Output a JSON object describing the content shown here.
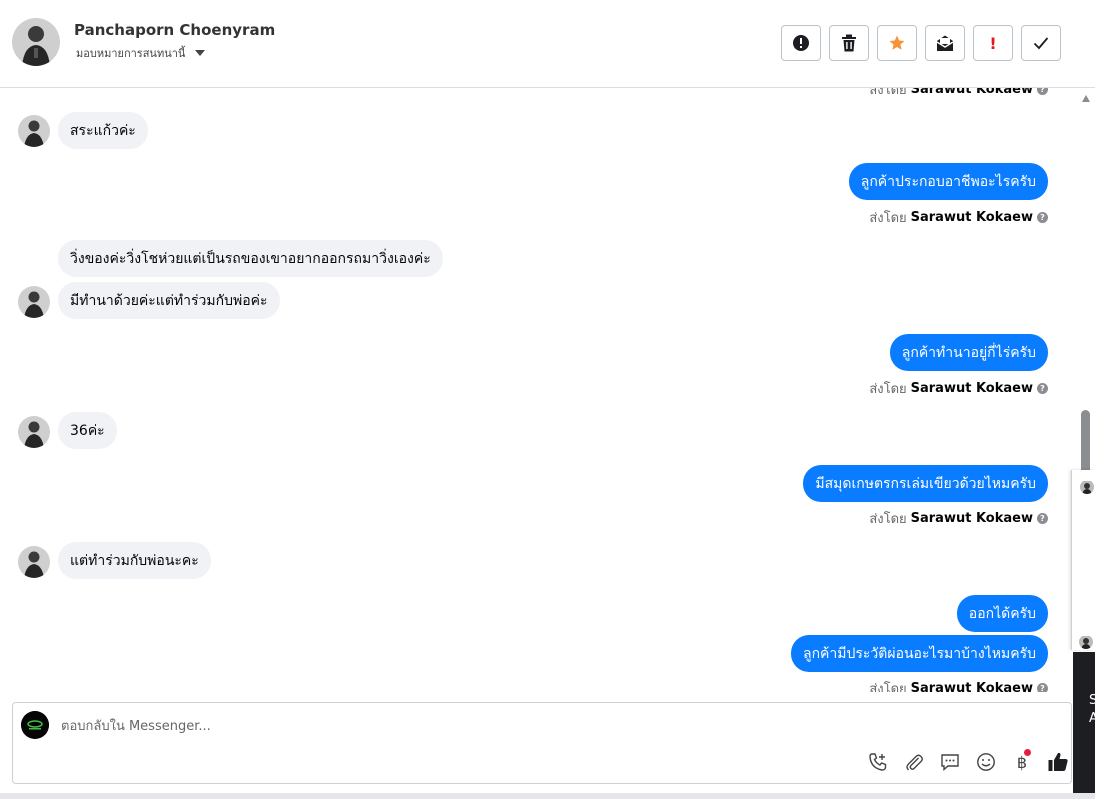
{
  "header": {
    "name": "Panchaporn Choenyram",
    "assign_label": "มอบหมายการสนทนานี้"
  },
  "actions": [
    {
      "name": "spam-alert-button",
      "icon": "alert-circle-icon"
    },
    {
      "name": "delete-button",
      "icon": "trash-icon"
    },
    {
      "name": "star-button",
      "icon": "star-icon"
    },
    {
      "name": "mark-unread-button",
      "icon": "envelope-icon"
    },
    {
      "name": "follow-up-button",
      "icon": "exclamation-icon",
      "label": "!"
    },
    {
      "name": "done-button",
      "icon": "check-icon"
    }
  ],
  "thread": {
    "sent_by_prefix": "ส่งโดย",
    "sender_name": "Sarawut Kokaew",
    "messages": [
      {
        "dir": "in",
        "text": "สระแก้วค่ะ"
      },
      {
        "dir": "out",
        "text": "ลูกค้าประกอบอาชีพอะไรครับ"
      },
      {
        "dir": "in",
        "text": "วิ่งของค่ะวิ่งโชห่วยแต่เป็นรถของเขาอยากออกรถมาวิ่งเองค่ะ"
      },
      {
        "dir": "in",
        "text": "มีทำนาด้วยค่ะแต่ทำร่วมกับพ่อค่ะ"
      },
      {
        "dir": "out",
        "text": "ลูกค้าทำนาอยู่กี่ไร่ครับ"
      },
      {
        "dir": "in",
        "text": "36ค่ะ"
      },
      {
        "dir": "out",
        "text": "มีสมุดเกษตรกรเล่มเขียวด้วยไหมครับ"
      },
      {
        "dir": "in",
        "text": "แต่ทำร่วมกับพ่อนะคะ"
      },
      {
        "dir": "out",
        "text": "ออกได้ครับ"
      },
      {
        "dir": "out",
        "text": "ลูกค้ามีประวัติผ่อนอะไรมาบ้างไหมครับ"
      }
    ]
  },
  "composer": {
    "placeholder": "ตอบกลับใน Messenger...",
    "tools": [
      "call-add-icon",
      "attachment-icon",
      "saved-reply-icon",
      "emoji-icon",
      "baht-icon",
      "thumbs-up-icon"
    ],
    "baht_symbol": "฿"
  },
  "side_peek": {
    "text": "S\nA"
  },
  "colors": {
    "outgoing_bubble": "#0a7cff",
    "incoming_bubble": "#f0f2f5",
    "star": "#f7923b",
    "alert_red": "#e4161e"
  }
}
